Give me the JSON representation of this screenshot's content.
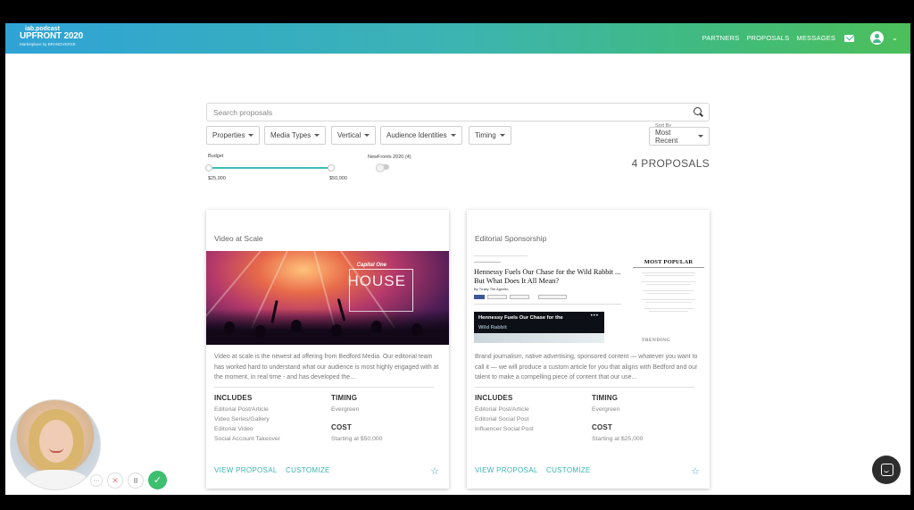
{
  "header": {
    "logo_line1": "iab.podcast",
    "logo_line2": "UPFRONT 2020",
    "logo_line3": "Marketplace by BRANDVERSE",
    "nav": [
      "PARTNERS",
      "PROPOSALS",
      "MESSAGES"
    ],
    "icons": {
      "mail": "mail-icon",
      "account": "user-circle-icon",
      "chevron": "chevron-down-icon"
    },
    "gradient": [
      "#2fa3d6",
      "#3cb4b2",
      "#4cbf5a"
    ]
  },
  "search": {
    "placeholder": "Search proposals",
    "value": ""
  },
  "filters": [
    {
      "label": "Properties"
    },
    {
      "label": "Media Types"
    },
    {
      "label": "Vertical"
    },
    {
      "label": "Audience Identities"
    },
    {
      "label": "Timing"
    }
  ],
  "sort": {
    "label": "Sort By",
    "value": "Most Recent"
  },
  "budget": {
    "label": "Budget",
    "min": "$25,000",
    "max": "$50,000"
  },
  "newfronts": {
    "label": "NewFronts 2020 (4)",
    "enabled": false
  },
  "results": {
    "count_label": "4 PROPOSALS"
  },
  "cards": [
    {
      "category": "Video at Scale",
      "image_caption": {
        "brand": "Capital One",
        "word": "HOUSE"
      },
      "description": "Video at scale is the newest ad offering from Bedford Media. Our editorial team has worked hard to understand what our audience is most highly engaged with at the moment, in real time - and has developed the...",
      "includes_title": "INCLUDES",
      "includes": [
        "Editorial Post/Article",
        "Video Series/Gallery",
        "Editorial Video",
        "Social Account Takeover"
      ],
      "timing_title": "TIMING",
      "timing": "Evergreen",
      "cost_title": "COST",
      "cost": "Starting at $50,000",
      "view_label": "VIEW PROPOSAL",
      "customize_label": "CUSTOMIZE"
    },
    {
      "category": "Editorial Sponsorship",
      "article": {
        "headline": "Hennessy Fuels Our Chase for the Wild Rabbit ... But What Does It All Mean?",
        "byline": "By Trusty Tim Agnello",
        "video_title": "Hennessy Fuels Our Chase for the",
        "video_title2": "Wild Rabbit",
        "side_title": "MOST POPULAR",
        "side_bottom": "TRENDING"
      },
      "description": "Brand journalism, native advertising, sponsored content — whatever you want to call it — we will produce a custom article for you that aligns with Bedford and our talent to make a compelling piece of content that our use...",
      "includes_title": "INCLUDES",
      "includes": [
        "Editorial Post/Article",
        "Editorial Social Post",
        "Influencer Social Post"
      ],
      "timing_title": "TIMING",
      "timing": "Evergreen",
      "cost_title": "COST",
      "cost": "Starting at $25,000",
      "view_label": "VIEW PROPOSAL",
      "customize_label": "CUSTOMIZE"
    }
  ],
  "call_controls": {
    "more": "···",
    "close": "✕",
    "pause": "II",
    "confirm": "✓"
  },
  "colors": {
    "accent": "#3bb4b0",
    "confirm": "#3dbf6f",
    "star": "#3ba9c6"
  }
}
